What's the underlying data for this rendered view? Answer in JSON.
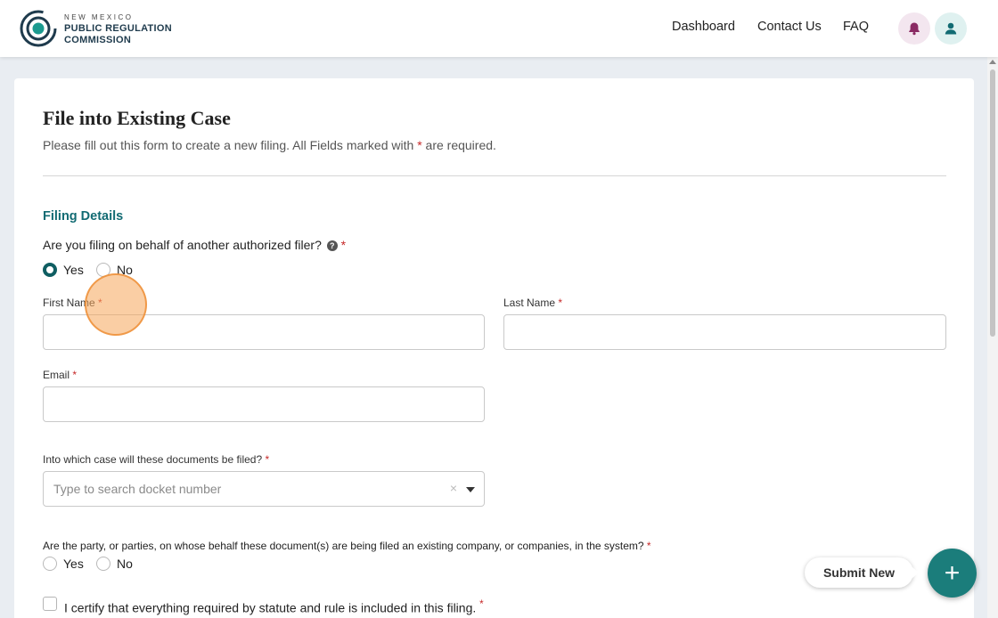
{
  "header": {
    "logo": {
      "line1": "NEW MEXICO",
      "line2": "PUBLIC REGULATION",
      "line3": "COMMISSION",
      "icon": "prc-logo-icon"
    },
    "nav": [
      "Dashboard",
      "Contact Us",
      "FAQ"
    ],
    "notification_icon": "bell-icon",
    "account_icon": "user-icon"
  },
  "form": {
    "title": "File into Existing Case",
    "subtitle_before": "Please fill out this form to create a new filing. All Fields marked with ",
    "subtitle_after": " are required.",
    "required_marker": "*",
    "section_title": "Filing Details",
    "behalf_question": "Are you filing on behalf of another authorized filer?",
    "behalf_options": [
      "Yes",
      "No"
    ],
    "behalf_selected": "Yes",
    "first_name": {
      "label": "First Name",
      "value": ""
    },
    "last_name": {
      "label": "Last Name",
      "value": ""
    },
    "email": {
      "label": "Email",
      "value": ""
    },
    "case_question": "Into which case will these documents be filed?",
    "case_placeholder": "Type to search docket number",
    "clear_symbol": "×",
    "company_question": "Are the party, or parties, on whose behalf these document(s) are being filed an existing company, or companies, in the system?",
    "company_options": [
      "Yes",
      "No"
    ],
    "certify_text": "I certify that everything required by statute and rule is included in this filing."
  },
  "actions": {
    "submit_new_label": "Submit New",
    "fab_symbol": "+"
  },
  "colors": {
    "accent": "#126b73",
    "fab": "#1b7d7b",
    "required": "#c62828"
  }
}
